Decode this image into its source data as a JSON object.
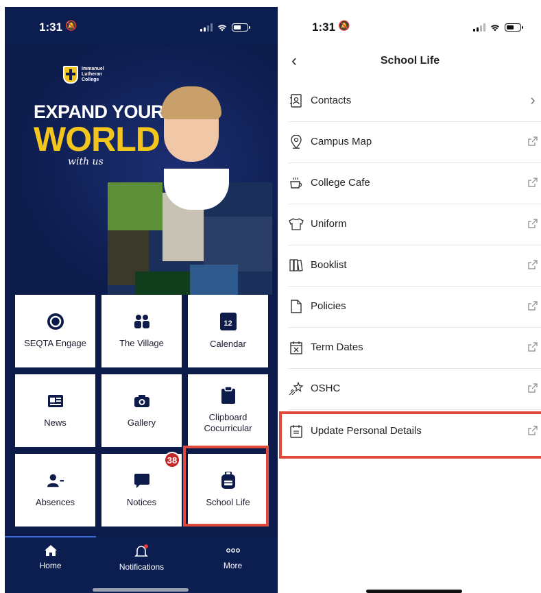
{
  "left": {
    "status": {
      "time": "1:31"
    },
    "hero": {
      "logo_lines": [
        "Immanuel",
        "Lutheran",
        "College"
      ],
      "headline1": "EXPAND YOUR",
      "headline2": "WORLD",
      "tagline": "with us"
    },
    "tiles": [
      {
        "label": "SEQTA Engage",
        "icon": "seqta-icon"
      },
      {
        "label": "The Village",
        "icon": "people-icon"
      },
      {
        "label": "Calendar",
        "icon": "calendar-icon",
        "icon_text": "12"
      },
      {
        "label": "News",
        "icon": "newspaper-icon"
      },
      {
        "label": "Gallery",
        "icon": "camera-icon"
      },
      {
        "label": "Clipboard Cocurricular",
        "icon": "clipboard-icon"
      },
      {
        "label": "Absences",
        "icon": "person-minus-icon"
      },
      {
        "label": "Notices",
        "icon": "message-icon",
        "badge": "38"
      },
      {
        "label": "School Life",
        "icon": "backpack-icon"
      }
    ],
    "tabbar": [
      {
        "label": "Home",
        "icon": "home-icon"
      },
      {
        "label": "Notifications",
        "icon": "bell-icon"
      },
      {
        "label": "More",
        "icon": "more-dots-icon"
      }
    ]
  },
  "right": {
    "status": {
      "time": "1:31"
    },
    "title": "School Life",
    "items": [
      {
        "label": "Contacts",
        "icon": "contacts-icon",
        "trailing": "chevron"
      },
      {
        "label": "Campus Map",
        "icon": "location-pin-icon",
        "trailing": "external"
      },
      {
        "label": "College Cafe",
        "icon": "coffee-cup-icon",
        "trailing": "external"
      },
      {
        "label": "Uniform",
        "icon": "shirt-icon",
        "trailing": "external"
      },
      {
        "label": "Booklist",
        "icon": "books-icon",
        "trailing": "external"
      },
      {
        "label": "Policies",
        "icon": "document-icon",
        "trailing": "external"
      },
      {
        "label": "Term Dates",
        "icon": "calendar-x-icon",
        "trailing": "external"
      },
      {
        "label": "OSHC",
        "icon": "sparkle-stars-icon",
        "trailing": "external"
      },
      {
        "label": "Update Personal Details",
        "icon": "form-icon",
        "trailing": "external"
      }
    ]
  },
  "colors": {
    "navy": "#0c1b4a",
    "gold": "#f4c51c",
    "highlight": "#e04a3c",
    "badge": "#c62828"
  }
}
